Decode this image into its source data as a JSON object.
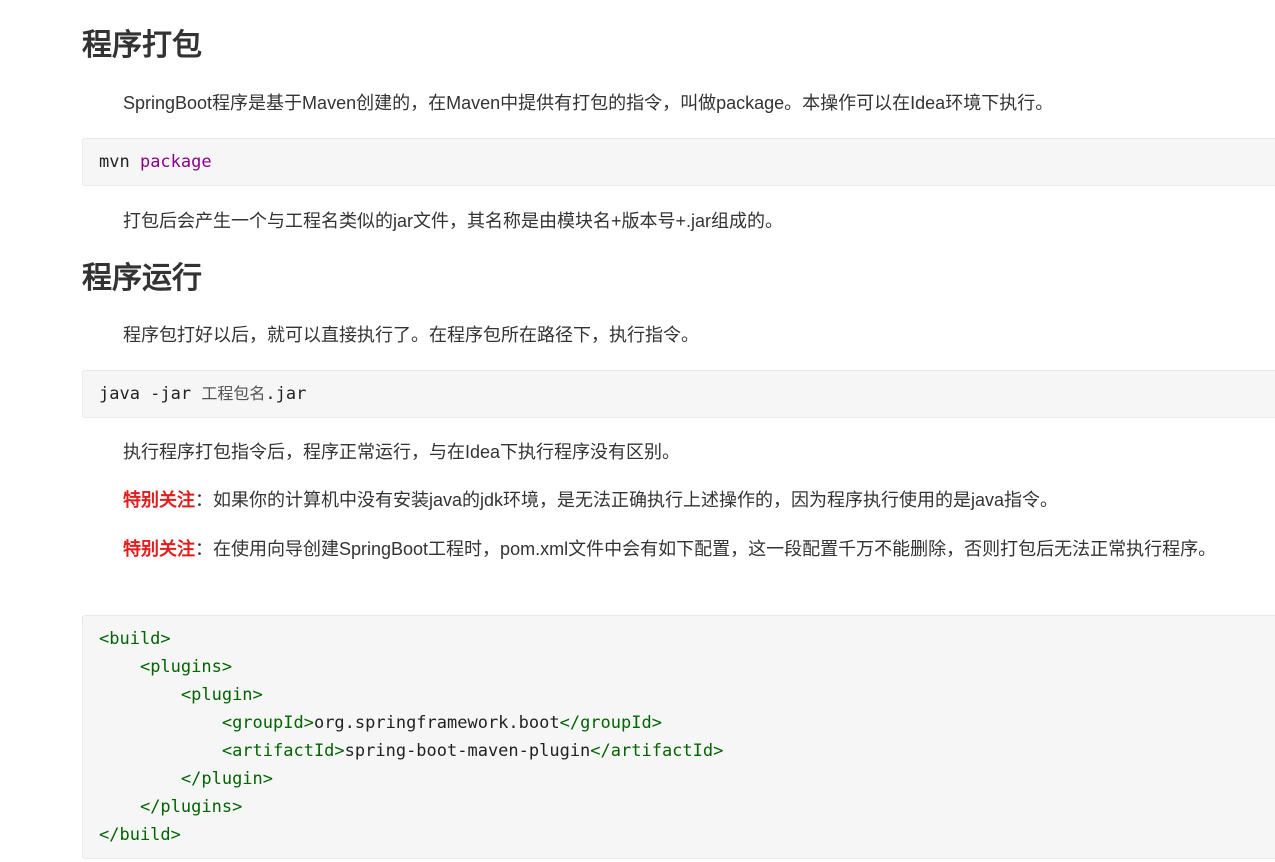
{
  "sections": [
    {
      "heading": "程序打包"
    },
    {
      "heading": "程序运行"
    }
  ],
  "paragraphs": {
    "p1": "SpringBoot程序是基于Maven创建的，在Maven中提供有打包的指令，叫做package。本操作可以在Idea环境下执行。",
    "p2": "打包后会产生一个与工程名类似的jar文件，其名称是由模块名+版本号+.jar组成的。",
    "p3": "程序包打好以后，就可以直接执行了。在程序包所在路径下，执行指令。",
    "p4": "执行程序打包指令后，程序正常运行，与在Idea下执行程序没有区别。",
    "note_label": "特别关注",
    "note1_text": "：如果你的计算机中没有安装java的jdk环境，是无法正确执行上述操作的，因为程序执行使用的是java指令。",
    "note2_text": "：在使用向导创建SpringBoot工程时，pom.xml文件中会有如下配置，这一段配置千万不能删除，否则打包后无法正常执行程序。"
  },
  "code_blocks": {
    "mvn": {
      "cmd": "mvn ",
      "arg": "package"
    },
    "java": {
      "cmd": "java -jar ",
      "arg": "工程包名",
      "ext": ".jar"
    },
    "xml": {
      "build_open": "<build>",
      "plugins_open": "<plugins>",
      "plugin_open": "<plugin>",
      "groupId_open": "<groupId>",
      "groupId_value": "org.springframework.boot",
      "groupId_close": "</groupId>",
      "artifactId_open": "<artifactId>",
      "artifactId_value": "spring-boot-maven-plugin",
      "artifactId_close": "</artifactId>",
      "plugin_close": "</plugin>",
      "plugins_close": "</plugins>",
      "build_close": "</build>"
    }
  }
}
